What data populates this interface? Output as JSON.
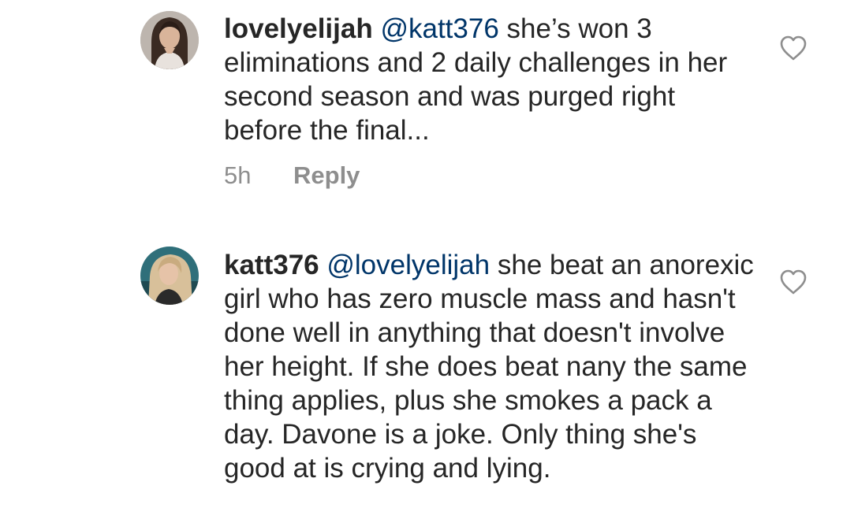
{
  "comments": [
    {
      "username": "lovelyelijah",
      "mention": "@katt376",
      "text": "she’s won 3 eliminations and 2 daily challenges in her second season and was purged right before the final...",
      "time": "5h",
      "reply_label": "Reply",
      "avatar_icon": "user-avatar",
      "like_icon": "heart-outline-icon"
    },
    {
      "username": "katt376",
      "mention": "@lovelyelijah",
      "text": "she beat an anorexic girl who has zero muscle mass and hasn't done well in anything that doesn't involve her height. If she does beat nany the same thing applies, plus she smokes a pack a day. Davone is a joke. Only thing she's good at is crying and lying.",
      "avatar_icon": "user-avatar",
      "like_icon": "heart-outline-icon"
    }
  ],
  "colors": {
    "text": "#262626",
    "mention": "#003569",
    "meta": "#8e8e8e",
    "icon": "#8e8e8e",
    "background": "#ffffff"
  }
}
